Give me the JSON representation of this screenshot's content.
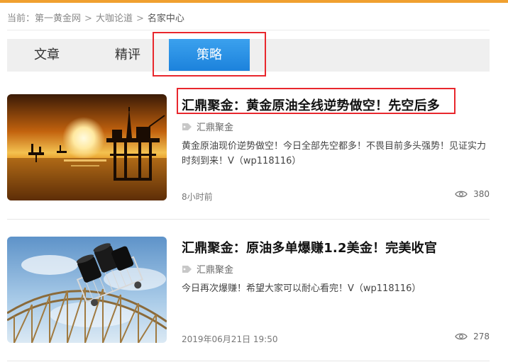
{
  "breadcrumb": {
    "prefix": "当前：",
    "items": [
      "第一黄金网",
      "大咖论道",
      "名家中心"
    ],
    "separator": ">"
  },
  "tabs": [
    {
      "label": "文章",
      "active": false
    },
    {
      "label": "精评",
      "active": false
    },
    {
      "label": "策略",
      "active": true
    }
  ],
  "articles": [
    {
      "title": "汇鼎聚金：黄金原油全线逆势做空！先空后多",
      "author": "汇鼎聚金",
      "summary": "黄金原油现价逆势做空！今日全部先空都多！不畏目前多头强势！见证实力时刻到来！V（wp118116）",
      "time": "8小时前",
      "views": "380",
      "image": "oil-rig-sunset-image"
    },
    {
      "title": "汇鼎聚金：原油多单爆赚1.2美金！完美收官",
      "author": "汇鼎聚金",
      "summary": "今日再次爆赚！希望大家可以耐心看完！V（wp118116）",
      "time": "2019年06月21日 19:50",
      "views": "278",
      "image": "oil-barrels-cart-image"
    }
  ],
  "colors": {
    "accent": "#f0a030",
    "active_tab": "#2a8fe6",
    "highlight": "#e8272d"
  }
}
